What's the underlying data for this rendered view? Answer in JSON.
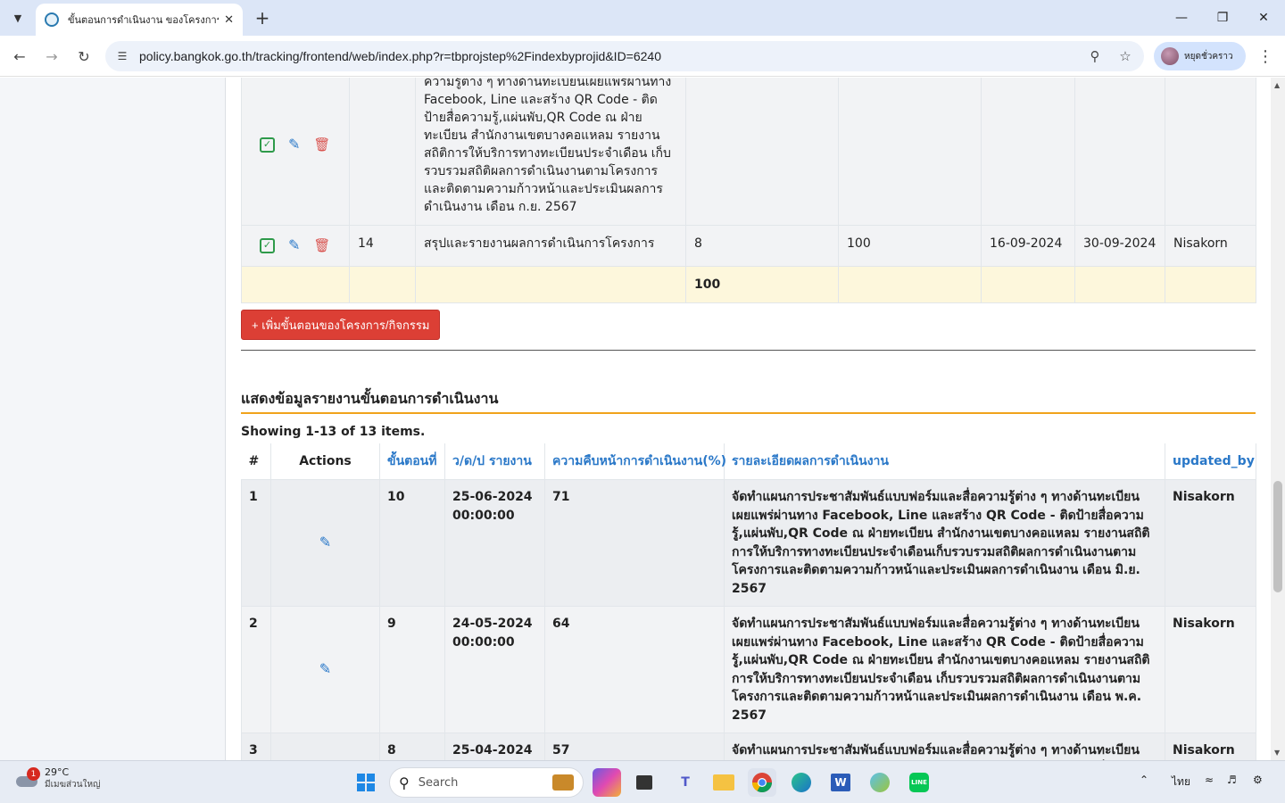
{
  "browser": {
    "tab_title": "ขั้นตอนการดำเนินงาน ของโครงการ:",
    "url": "policy.bangkok.go.th/tracking/frontend/web/index.php?r=tbprojstep%2Findexbyprojid&ID=6240",
    "profile_name": "หยุดชั่วคราว"
  },
  "steps_table": {
    "partial_row": {
      "detail": "ความรู้ต่าง ๆ ทางด้านทะเบียนเผยแพร่ผ่านทาง Facebook, Line และสร้าง QR Code - ติดป้ายสื่อความรู้,แผ่นพับ,QR Code ณ ฝ่ายทะเบียน สำนักงานเขตบางคอแหลม รายงานสถิติการให้บริการทางทะเบียนประจำเดือน เก็บรวบรวมสถิติผลการดำเนินงานตามโครงการ และติดตามความก้าวหน้าและประเมินผลการดำเนินงาน เดือน ก.ย. 2567"
    },
    "row14": {
      "no": "14",
      "name": "สรุปและรายงานผลการดำเนินการโครงการ",
      "weight": "8",
      "progress": "100",
      "start": "16-09-2024",
      "end": "30-09-2024",
      "by": "Nisakorn"
    },
    "total": "100"
  },
  "add_button_label": "+ เพิ่มขั้นตอนของโครงการ/กิจกรรม",
  "report": {
    "section_title": "แสดงข้อมูลรายงานขั้นตอนการดำเนินงาน",
    "summary": "Showing 1-13 of 13 items.",
    "headers": {
      "num": "#",
      "actions": "Actions",
      "step": "ขั้นตอนที่",
      "date": "ว/ด/ป รายงาน",
      "progress": "ความคืบหน้าการดำเนินงาน(%)",
      "detail": "รายละเอียดผลการดำเนินงาน",
      "updated_by": "updated_by"
    },
    "rows": [
      {
        "num": "1",
        "step": "10",
        "date": "25-06-2024 00:00:00",
        "progress": "71",
        "detail": "จัดทำแผนการประชาสัมพันธ์แบบฟอร์มและสื่อความรู้ต่าง ๆ ทางด้านทะเบียนเผยแพร่ผ่านทาง Facebook, Line และสร้าง QR Code - ติดป้ายสื่อความรู้,แผ่นพับ,QR Code ณ ฝ่ายทะเบียน สำนักงานเขตบางคอแหลม รายงานสถิติการให้บริการทางทะเบียนประจำเดือนเก็บรวบรวมสถิติผลการดำเนินงานตามโครงการและติดตามความก้าวหน้าและประเมินผลการดำเนินงาน เดือน มิ.ย. 2567",
        "by": "Nisakorn"
      },
      {
        "num": "2",
        "step": "9",
        "date": "24-05-2024 00:00:00",
        "progress": "64",
        "detail": "จัดทำแผนการประชาสัมพันธ์แบบฟอร์มและสื่อความรู้ต่าง ๆ ทางด้านทะเบียนเผยแพร่ผ่านทาง Facebook, Line และสร้าง QR Code - ติดป้ายสื่อความรู้,แผ่นพับ,QR Code ณ ฝ่ายทะเบียน สำนักงานเขตบางคอแหลม รายงานสถิติการให้บริการทางทะเบียนประจำเดือน เก็บรวบรวมสถิติผลการดำเนินงานตามโครงการและติดตามความก้าวหน้าและประเมินผลการดำเนินงาน เดือน พ.ค. 2567",
        "by": "Nisakorn"
      },
      {
        "num": "3",
        "step": "8",
        "date": "25-04-2024 00:00:00",
        "progress": "57",
        "detail": "จัดทำแผนการประชาสัมพันธ์แบบฟอร์มและสื่อความรู้ต่าง ๆ ทางด้านทะเบียนเผยแพร่ผ่านทาง Facebook, Line และสร้าง QR Code - ติดป้ายสื่อความรู้,แผ่นพับ,QR Code ณ ฝ่ายทะเบียน สำนักงานเขตบางคอแหลม รายงานสถิติการให้",
        "by": "Nisakorn"
      }
    ]
  },
  "taskbar": {
    "weather_temp": "29°C",
    "weather_desc": "มีเมฆส่วนใหญ่",
    "weather_badge": "1",
    "search_placeholder": "Search",
    "language": "ไทย"
  },
  "icons": {
    "check": "check-square-icon",
    "edit": "pencil-icon",
    "delete": "trash-icon"
  },
  "colors": {
    "add_button": "#dc3f35",
    "header_link": "#2a78c8",
    "section_underline": "#f0a31c",
    "total_row": "#fdf7dc"
  }
}
